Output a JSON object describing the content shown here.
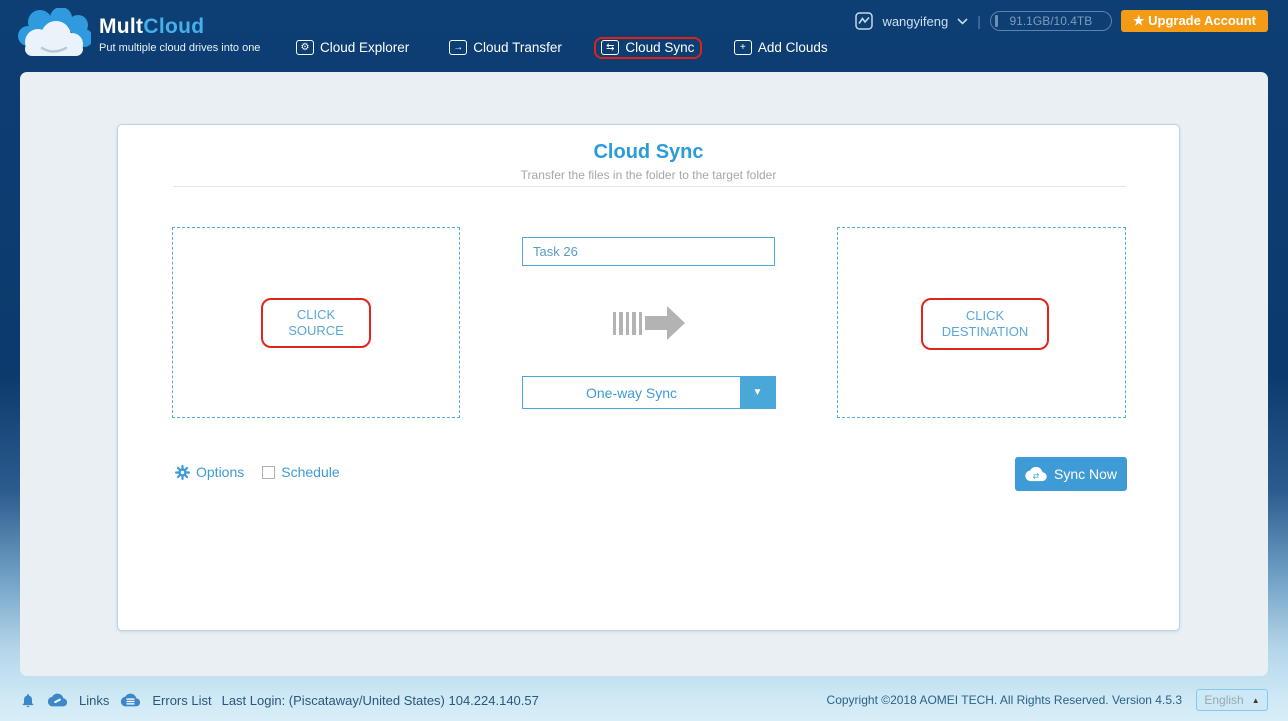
{
  "header": {
    "logo": {
      "brand_mult": "Mult",
      "brand_cloud": "Cloud",
      "tagline": "Put multiple cloud drives into one"
    },
    "nav": [
      {
        "label": "Cloud Explorer",
        "glyph": "⚙"
      },
      {
        "label": "Cloud Transfer",
        "glyph": "→"
      },
      {
        "label": "Cloud Sync",
        "glyph": "⇆"
      },
      {
        "label": "Add Clouds",
        "glyph": "+"
      }
    ],
    "user": {
      "name": "wangyifeng"
    },
    "separator": "|",
    "storage": "91.1GB/10.4TB",
    "upgrade_label": "★ Upgrade Account"
  },
  "main": {
    "title": "Cloud Sync",
    "subtitle": "Transfer the files in the folder to the target folder",
    "task_name": "Task 26",
    "source_label": "CLICK SOURCE",
    "destination_label": "CLICK DESTINATION",
    "sync_mode": "One-way Sync",
    "dropdown_arrow": "▼",
    "options_label": "Options",
    "schedule_label": "Schedule",
    "sync_button_label": "Sync Now"
  },
  "footer": {
    "links_label": "Links",
    "errors_label": "Errors List",
    "last_login": "Last Login: (Piscataway/United States) 104.224.140.57",
    "copyright": "Copyright ©2018 AOMEI TECH. All Rights Reserved. Version 4.5.3",
    "language": "English",
    "language_arrow": "▲"
  },
  "colors": {
    "header_navy": "#0c3b6f",
    "accent_blue": "#3e9bd5",
    "brand_cloud_blue": "#45b0ea",
    "annotation_red": "#e1251b",
    "upgrade_orange": "#f49b15",
    "panel_bg": "#e9eff3",
    "footer_text": "#2b567a"
  }
}
